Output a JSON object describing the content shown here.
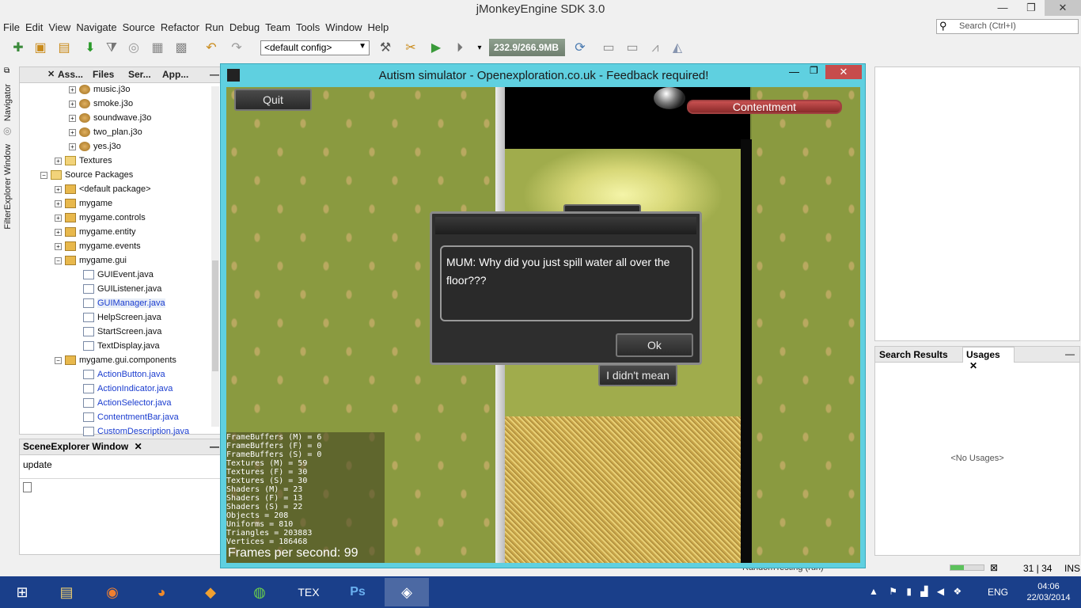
{
  "window": {
    "title": "jMonkeyEngine SDK 3.0",
    "minimize": "—",
    "maximize": "❐",
    "close": "✕"
  },
  "menu": [
    "File",
    "Edit",
    "View",
    "Navigate",
    "Source",
    "Refactor",
    "Run",
    "Debug",
    "Team",
    "Tools",
    "Window",
    "Help"
  ],
  "search": {
    "placeholder": "Search (Ctrl+I)"
  },
  "toolbar": {
    "config": "<default config>",
    "memory": "232.9/266.9MB"
  },
  "side_strip": {
    "navigator": "Navigator",
    "filter_explorer": "FilterExplorer Window"
  },
  "projects": {
    "tabs": [
      "Ass...",
      "Files",
      "Ser...",
      "App..."
    ],
    "tree": [
      {
        "label": "music.j3o",
        "type": "j3o",
        "link": false
      },
      {
        "label": "smoke.j3o",
        "type": "j3o",
        "link": false
      },
      {
        "label": "soundwave.j3o",
        "type": "j3o",
        "link": false
      },
      {
        "label": "two_plan.j3o",
        "type": "j3o",
        "link": false
      },
      {
        "label": "yes.j3o",
        "type": "j3o",
        "link": false
      },
      {
        "label": "Textures",
        "type": "folder",
        "link": false
      },
      {
        "label": "Source Packages",
        "type": "folder",
        "link": false
      },
      {
        "label": "<default package>",
        "type": "pkg",
        "link": false
      },
      {
        "label": "mygame",
        "type": "pkg",
        "link": false
      },
      {
        "label": "mygame.controls",
        "type": "pkg",
        "link": false
      },
      {
        "label": "mygame.entity",
        "type": "pkg",
        "link": false
      },
      {
        "label": "mygame.events",
        "type": "pkg",
        "link": false
      },
      {
        "label": "mygame.gui",
        "type": "pkg",
        "link": false
      },
      {
        "label": "GUIEvent.java",
        "type": "java",
        "link": false
      },
      {
        "label": "GUIListener.java",
        "type": "java",
        "link": false
      },
      {
        "label": "GUIManager.java",
        "type": "java",
        "link": true
      },
      {
        "label": "HelpScreen.java",
        "type": "java",
        "link": false
      },
      {
        "label": "StartScreen.java",
        "type": "java",
        "link": false
      },
      {
        "label": "TextDisplay.java",
        "type": "java",
        "link": false
      },
      {
        "label": "mygame.gui.components",
        "type": "pkg",
        "link": false
      },
      {
        "label": "ActionButton.java",
        "type": "java",
        "link": true
      },
      {
        "label": "ActionIndicator.java",
        "type": "java",
        "link": true
      },
      {
        "label": "ActionSelector.java",
        "type": "java",
        "link": true
      },
      {
        "label": "ContentmentBar.java",
        "type": "java",
        "link": true
      },
      {
        "label": "CustomDescription.java",
        "type": "java",
        "link": true
      }
    ]
  },
  "scene_explorer": {
    "title": "SceneExplorer Window",
    "close": "✕",
    "value": "update"
  },
  "usages": {
    "tab1": "Search Results",
    "tab2": "Usages",
    "close": "✕",
    "empty": "<No Usages>"
  },
  "status": {
    "running": "RandomTesting (run)",
    "position": "31 | 34",
    "mode": "INS",
    "progress": 0.4
  },
  "game": {
    "title": "Autism simulator - Openexploration.co.uk - Feedback required!",
    "quit": "Quit",
    "contentment": "Contentment",
    "dialog_message": "MUM: Why did you just spill water all over the floor???",
    "ok": "Ok",
    "response_button": "I didn't mean",
    "stats": [
      "FrameBuffers (M) = 6",
      "FrameBuffers (F) = 0",
      "FrameBuffers (S) = 0",
      "Textures (M) = 59",
      "Textures (F) = 30",
      "Textures (S) = 30",
      "Shaders (M) = 23",
      "Shaders (F) = 13",
      "Shaders (S) = 22",
      "Objects = 208",
      "Uniforms = 810",
      "Triangles = 203883",
      "Vertices = 186468"
    ],
    "fps": "Frames per second: 99"
  },
  "taskbar": {
    "apps": [
      "windows-start",
      "file-explorer",
      "firefox",
      "blender",
      "jmonkey-sdk",
      "spotify",
      "texworks",
      "photoshop",
      "autism-simulator"
    ],
    "language": "ENG",
    "time": "04:06",
    "date": "22/03/2014"
  }
}
